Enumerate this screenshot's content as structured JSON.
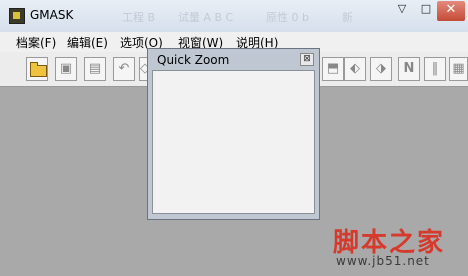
{
  "window": {
    "title": "GMASK",
    "ghost_labels": [
      "工程 B",
      "试量 A B C",
      "原性 0 b",
      "新"
    ]
  },
  "menu": [
    "档案(F)",
    "编辑(E)",
    "选项(O)",
    "视窗(W)",
    "说明(H)"
  ],
  "toolbar": {
    "icons": [
      {
        "name": "open-folder-icon",
        "glyph": ""
      },
      {
        "name": "save-icon",
        "glyph": "▣"
      },
      {
        "name": "save-as-icon",
        "glyph": "▤"
      },
      {
        "name": "undo-icon",
        "glyph": "↶"
      },
      {
        "name": "tool-5-icon",
        "glyph": "◇"
      },
      {
        "name": "tool-6-icon",
        "glyph": "⬒"
      },
      {
        "name": "tool-7-icon",
        "glyph": "⬖"
      },
      {
        "name": "tool-8-icon",
        "glyph": "⬗"
      },
      {
        "name": "n-icon",
        "glyph": "N"
      },
      {
        "name": "barcode-icon",
        "glyph": "‖"
      },
      {
        "name": "tool-11-icon",
        "glyph": "▦"
      }
    ]
  },
  "quick_zoom": {
    "title": "Quick Zoom",
    "close_glyph": "⊠"
  },
  "watermark": {
    "main": "脚本之家",
    "url": "www.jb51.net"
  }
}
